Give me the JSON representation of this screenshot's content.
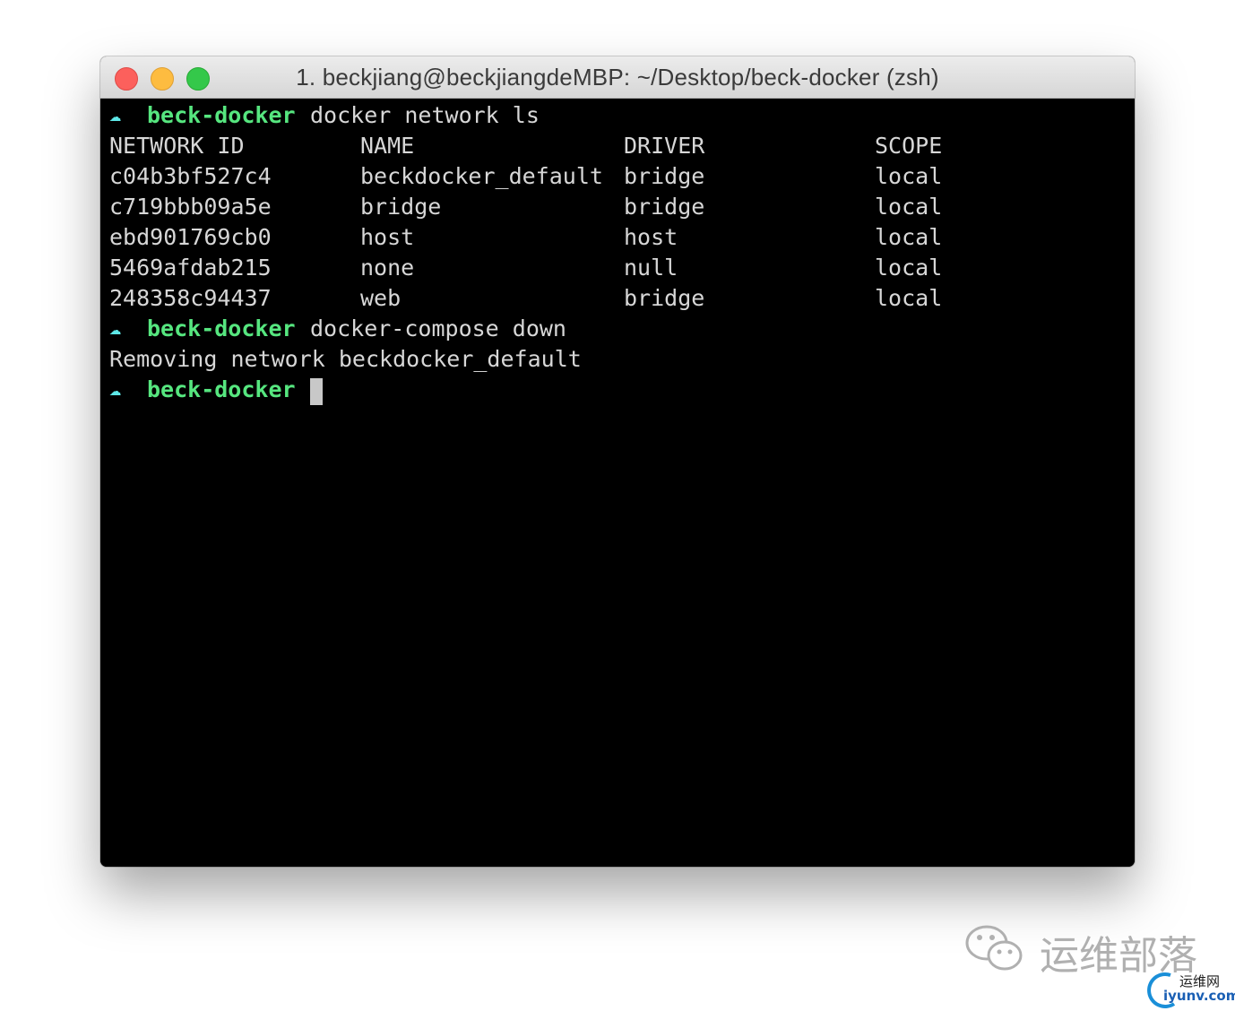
{
  "window": {
    "title": "1. beckjiang@beckjiangdeMBP: ~/Desktop/beck-docker (zsh)"
  },
  "prompt": {
    "icon": "☁",
    "dir": "beck-docker"
  },
  "commands": [
    "docker network ls",
    "docker-compose down"
  ],
  "table": {
    "headers": [
      "NETWORK ID",
      "NAME",
      "DRIVER",
      "SCOPE"
    ],
    "rows": [
      [
        "c04b3bf527c4",
        "beckdocker_default",
        "bridge",
        "local"
      ],
      [
        "c719bbb09a5e",
        "bridge",
        "bridge",
        "local"
      ],
      [
        "ebd901769cb0",
        "host",
        "host",
        "local"
      ],
      [
        "5469afdab215",
        "none",
        "null",
        "local"
      ],
      [
        "248358c94437",
        "web",
        "bridge",
        "local"
      ]
    ]
  },
  "output": {
    "removing": "Removing network beckdocker_default"
  },
  "watermark": {
    "text": "运维部落",
    "logo_line1": "运维网",
    "logo_line2": "iyunv.com"
  }
}
